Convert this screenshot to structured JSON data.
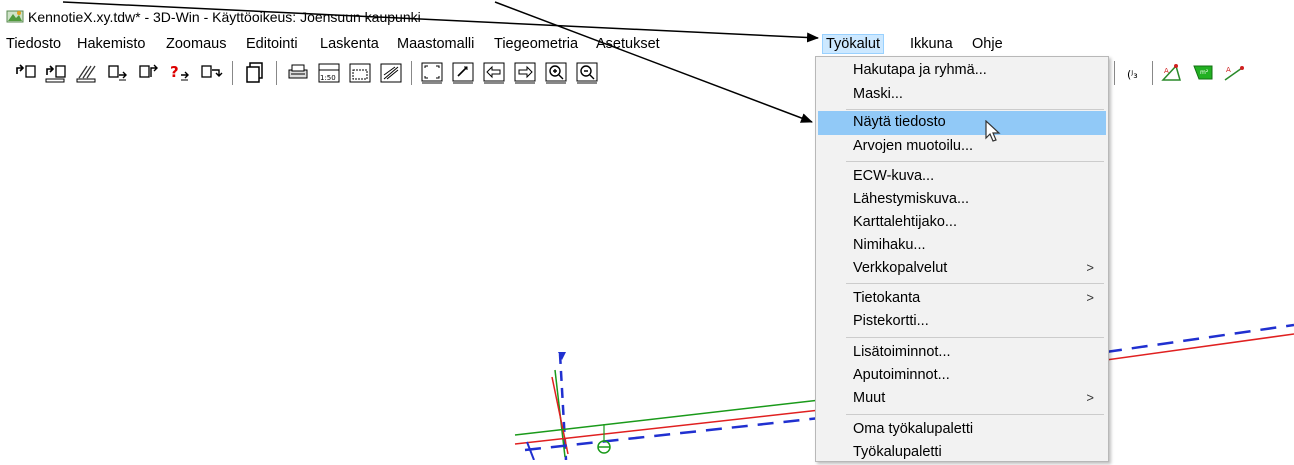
{
  "window": {
    "title": "KennotieX.xy.tdw* - 3D-Win - Käyttöoikeus: Joensuun kaupunki",
    "icon": "app-logo-icon"
  },
  "menubar": {
    "items": [
      {
        "label": "Tiedosto"
      },
      {
        "label": "Hakemisto"
      },
      {
        "label": "Zoomaus"
      },
      {
        "label": "Editointi"
      },
      {
        "label": "Laskenta"
      },
      {
        "label": "Maastomalli"
      },
      {
        "label": "Tiegeometria"
      },
      {
        "label": "Asetukset"
      },
      {
        "label": "Työkalut",
        "active": true
      },
      {
        "label": "Ikkuna"
      },
      {
        "label": "Ohje"
      }
    ]
  },
  "toolbar": {
    "buttons": [
      "new-file-icon",
      "open-file-icon",
      "copy-file-icon",
      "file-arrow-icon",
      "file-export-icon",
      "file-query-icon",
      "file-next-icon",
      "document-stack-icon",
      "print-icon",
      "scale-1-50-icon",
      "print-area-icon",
      "print-preview-icon",
      "zoom-extents-icon",
      "zoom-window-icon",
      "pan-left-icon",
      "pan-right-icon",
      "zoom-in-icon",
      "zoom-out-icon",
      "numbering-icon",
      "measure-angle-icon",
      "area-icon",
      "measure-line-icon"
    ],
    "scale_label": "1:50"
  },
  "dropdown": {
    "menu": "Työkalut",
    "items": [
      {
        "label": "Hakutapa ja ryhmä...",
        "group": 1
      },
      {
        "label": "Maski...",
        "group": 1
      },
      {
        "label": "Näytä tiedosto",
        "group": 2,
        "highlighted": true
      },
      {
        "label": "Arvojen muotoilu...",
        "group": 2
      },
      {
        "label": "ECW-kuva...",
        "group": 3
      },
      {
        "label": "Lähestymiskuva...",
        "group": 3
      },
      {
        "label": "Karttalehtijako...",
        "group": 3
      },
      {
        "label": "Nimihaku...",
        "group": 3
      },
      {
        "label": "Verkkopalvelut",
        "group": 3,
        "submenu": true
      },
      {
        "label": "Tietokanta",
        "group": 4,
        "submenu": true
      },
      {
        "label": "Pistekortti...",
        "group": 4
      },
      {
        "label": "Lisätoiminnot...",
        "group": 5
      },
      {
        "label": "Aputoiminnot...",
        "group": 5
      },
      {
        "label": "Muut",
        "group": 5,
        "submenu": true
      },
      {
        "label": "Oma työkalupaletti",
        "group": 6
      },
      {
        "label": "Työkalupaletti",
        "group": 6
      }
    ],
    "submenu_glyph": ">"
  },
  "colors": {
    "menu_active_bg": "#cce8ff",
    "menu_highlight": "#91c9f7",
    "line_red": "#e02020",
    "line_blue": "#2030d0",
    "line_green": "#1a9a1a"
  }
}
